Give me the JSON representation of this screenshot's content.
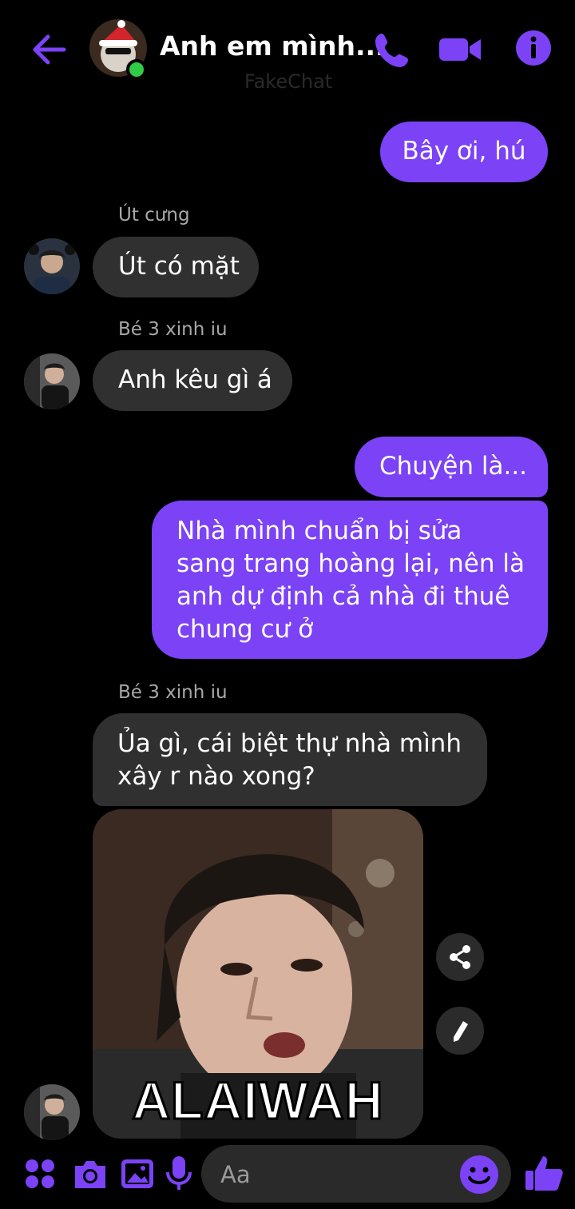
{
  "header": {
    "title": "Anh em mình...",
    "watermark": "FakeChat"
  },
  "messages": [
    {
      "side": "out",
      "text": "Bây ơi, hú"
    },
    {
      "side": "in",
      "sender": "Út cưng",
      "text": "Út có mặt"
    },
    {
      "side": "in",
      "sender": "Bé 3 xinh iu",
      "text": "Anh kêu gì á"
    },
    {
      "side": "out",
      "text": "Chuyện là..."
    },
    {
      "side": "out",
      "text": "Nhà mình chuẩn bị sửa sang trang hoàng lại, nên là anh dự định cả nhà đi thuê chung cư ở"
    },
    {
      "side": "in",
      "sender": "Bé 3 xinh iu",
      "text": "Ủa gì, cái biệt thự nhà mình xây r nào xong?"
    },
    {
      "side": "in",
      "sender": "Bé 3 xinh iu",
      "type": "image",
      "caption": "ALAIWAH"
    }
  ],
  "composer": {
    "placeholder": "Aa"
  },
  "colors": {
    "accent": "#7b42f6",
    "incoming": "#303030",
    "online": "#31cc46"
  },
  "icons": [
    "back-arrow-icon",
    "phone-icon",
    "video-icon",
    "info-icon",
    "share-icon",
    "edit-icon",
    "apps-icon",
    "camera-icon",
    "gallery-icon",
    "mic-icon",
    "emoji-icon",
    "like-icon"
  ]
}
